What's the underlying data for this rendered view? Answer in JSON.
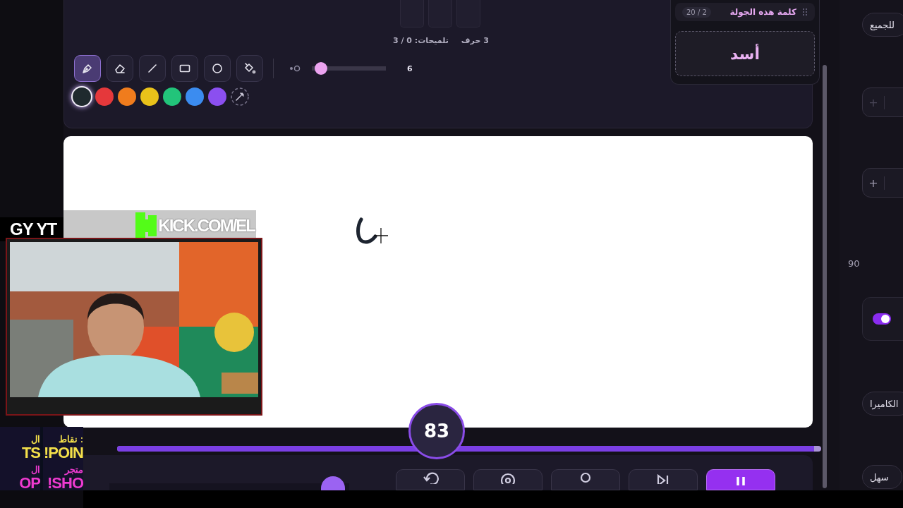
{
  "letter_slots": [
    {
      "filled": false
    },
    {
      "filled": false
    },
    {
      "filled": false
    }
  ],
  "letter_count": "3 حرف",
  "hints": "تلميحات: 0 / 3",
  "tools": [
    {
      "kind": "pen",
      "selected": true
    },
    {
      "kind": "eraser",
      "selected": false
    },
    {
      "kind": "line",
      "selected": false
    },
    {
      "kind": "rectangle",
      "selected": false
    },
    {
      "kind": "circle",
      "selected": false
    },
    {
      "kind": "fill",
      "selected": false
    }
  ],
  "brush_size": {
    "level": 0.07,
    "value": "6"
  },
  "colors": [
    {
      "color": "#1f2a2e",
      "selected": true
    },
    {
      "color": "#e5383b",
      "selected": false
    },
    {
      "color": "#f07c1d",
      "selected": false
    },
    {
      "color": "#e9c21a",
      "selected": false
    },
    {
      "color": "#22c47a",
      "selected": false
    },
    {
      "color": "#3b8cf0",
      "selected": false
    },
    {
      "color": "#8b4ff0",
      "selected": false
    }
  ],
  "timer": "83",
  "round_progress": {
    "level": 0.99
  },
  "controls": [
    {
      "kind": "undo",
      "selected": false
    },
    {
      "kind": "eye",
      "selected": false
    },
    {
      "kind": "search",
      "selected": false
    },
    {
      "kind": "skip",
      "selected": false
    },
    {
      "kind": "pause",
      "selected": true
    }
  ],
  "word_card": {
    "title": "كلمة هذه الجولة",
    "count": "2 / 20",
    "word": "أسد"
  },
  "time_slider": {
    "level": 0.98
  },
  "sidebar": [
    {
      "kind": "chip",
      "label": "للجميع"
    },
    {
      "kind": "stepper",
      "disabled": true,
      "button": "+"
    },
    {
      "kind": "stepper",
      "disabled": false,
      "button": "+"
    },
    {
      "kind": "value",
      "label": "90"
    },
    {
      "kind": "toggle",
      "on": true
    },
    {
      "kind": "chip",
      "label": "الكاميرا"
    },
    {
      "kind": "chip",
      "label": "سهل"
    }
  ],
  "stream_overlay": {
    "handle": "GY YT",
    "link": "KICK.COM/EL",
    "commands": [
      {
        "label": "نقاط :",
        "command": "!POIN",
        "extra": "متجر",
        "command2": "!SHO"
      },
      {
        "label": "ال",
        "command": "TS",
        "extra": "ال",
        "command2": "OP"
      }
    ]
  }
}
